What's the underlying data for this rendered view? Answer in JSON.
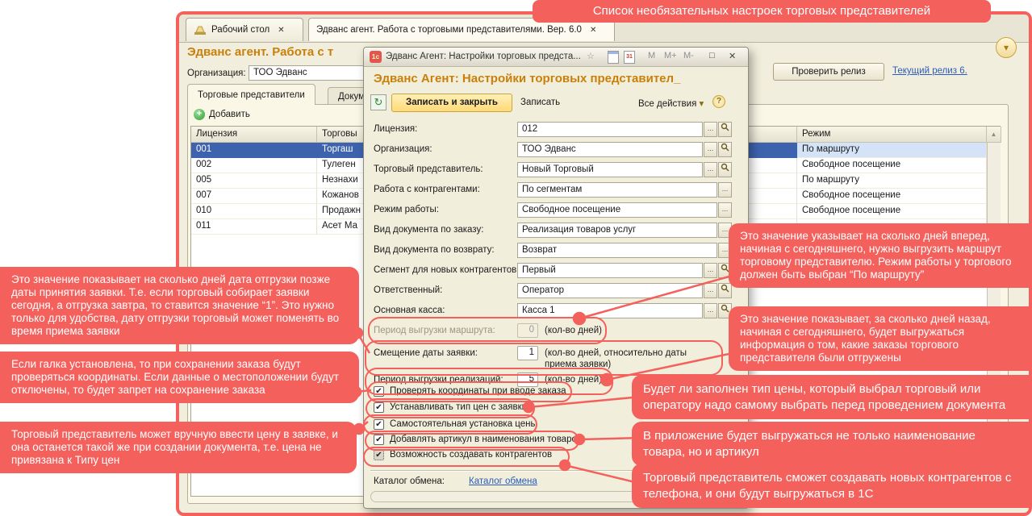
{
  "colors": {
    "annotation_pink": "#F4605C",
    "selection_blue": "#3D63AE",
    "selection_light_blue": "#D4E3F8",
    "title_orange": "#C8800A",
    "link_blue": "#2A5CB8",
    "window_cream": "#F2EEDD"
  },
  "glyphs": {
    "close": "✕",
    "dropdown": "▾",
    "up": "▲",
    "check": "✔",
    "ellipsis": "...",
    "help": "?",
    "m": "M",
    "m_plus": "M+",
    "m_minus": "M-",
    "star": "☆",
    "calendar": "31",
    "refresh": "↻",
    "maximize": "□",
    "logo": "1с",
    "plus": "+"
  },
  "main": {
    "tabs": [
      {
        "label": "Рабочий стол"
      },
      {
        "label": "Эдванс агент. Работа с торговыми представителями. Вер. 6.0"
      }
    ],
    "title": "Эдванс агент. Работа с т",
    "org_label": "Организация:",
    "org_value": "ТОО Эдванс",
    "check_release": "Проверить релиз",
    "current_release": "Текущий релиз 6.",
    "section_tabs": [
      {
        "label": "Торговые представители"
      },
      {
        "label": "Документ"
      }
    ],
    "add_button": "Добавить",
    "table": {
      "col_license": "Лицензия",
      "col_name": "Торговы",
      "col_mode": "Режим",
      "rows": [
        {
          "license": "001",
          "name": "Торгаш",
          "mode": "По маршруту"
        },
        {
          "license": "002",
          "name": "Тулеген",
          "mode": "Свободное посещение"
        },
        {
          "license": "005",
          "name": "Незнахи",
          "mode": "По маршруту"
        },
        {
          "license": "007",
          "name": "Кожанов",
          "mode": "Свободное посещение"
        },
        {
          "license": "010",
          "name": "Продажн",
          "mode": "Свободное посещение"
        },
        {
          "license": "011",
          "name": "Асет Ма",
          "mode": ""
        }
      ]
    }
  },
  "dialog": {
    "titlebar_title": "Эдванс Агент: Настройки торговых предста...",
    "header": "Эдванс Агент: Настройки торговых представител_",
    "toolbar": {
      "save_close": "Записать и закрыть",
      "save": "Записать",
      "all_actions": "Все действия"
    },
    "fields": [
      {
        "label": "Лицензия:",
        "value": "012"
      },
      {
        "label": "Организация:",
        "value": "ТОО Эдванс"
      },
      {
        "label": "Торговый представитель:",
        "value": "Новый Торговый"
      },
      {
        "label": "Работа с контрагентами:",
        "value": "По сегментам"
      },
      {
        "label": "Режим работы:",
        "value": "Свободное посещение"
      },
      {
        "label": "Вид документа по заказу:",
        "value": "Реализация товаров услуг"
      },
      {
        "label": "Вид документа по возврату:",
        "value": "Возврат"
      },
      {
        "label": "Сегмент для новых контрагентов:",
        "value": "Первый"
      },
      {
        "label": "Ответственный:",
        "value": "Оператор"
      },
      {
        "label": "Основная касса:",
        "value": "Касса 1"
      }
    ],
    "numeric": [
      {
        "label": "Период выгрузки маршрута:",
        "value": "0",
        "hint": "(кол-во дней)",
        "disabled": true
      },
      {
        "label": "Смещение даты заявки:",
        "value": "1",
        "hint": "(кол-во дней, относительно даты приема заявки)",
        "disabled": false
      },
      {
        "label": "Период выгрузки реализаций:",
        "value": "5",
        "hint": "(кол-во дней)",
        "disabled": false
      }
    ],
    "checkboxes": [
      {
        "label": "Проверять координаты при вводе заказа",
        "checked": true
      },
      {
        "label": "Устанавливать тип цен с заявки",
        "checked": true
      },
      {
        "label": "Самостоятельная установка цены",
        "checked": true
      },
      {
        "label": "Добавлять артикул в наименования товаров",
        "checked": true
      },
      {
        "label": "Возможность создавать контрагентов",
        "checked": true
      }
    ],
    "catalog_label": "Каталог обмена:",
    "catalog_link": "Каталог обмена"
  },
  "callouts": {
    "banner": "Список необязательных настроек торговых представителей",
    "left": [
      {
        "text": "Это значение показывает на сколько дней дата отгрузки позже даты принятия заявки. Т.е. если торговый собирает заявки сегодня, а отгрузка завтра, то ставится значение “1”. Это нужно только для удобства, дату отгрузки торговый может поменять во время приема заявки"
      },
      {
        "text": "Если галка установлена, то при сохранении заказа будут проверяться координаты. Если данные о местоположении будут отключены, то будет запрет на сохранение заказа"
      },
      {
        "text": "Торговый представитель может вручную ввести цену в заявке, и она останется такой же при создании документа, т.е. цена не привязана к Типу цен"
      }
    ],
    "right": [
      {
        "text": "Это значение указывает на сколько дней вперед, начиная с сегодняшнего, нужно выгрузить маршрут торговому представителю. Режим работы у торгового должен быть выбран “По маршруту”"
      },
      {
        "text": "Это значение показывает, за сколько дней назад, начиная с сегодняшнего, будет выгружаться информация о том, какие заказы торгового представителя были отгружены"
      },
      {
        "text": "Будет ли заполнен тип цены, который выбрал торговый или оператору надо самому выбрать перед проведением документа"
      },
      {
        "text": "В приложение будет выгружаться не только наименование товара, но и артикул"
      },
      {
        "text": "Торговый представитель сможет создавать новых контрагентов с телефона, и они будут выгружаться в 1С"
      }
    ]
  }
}
